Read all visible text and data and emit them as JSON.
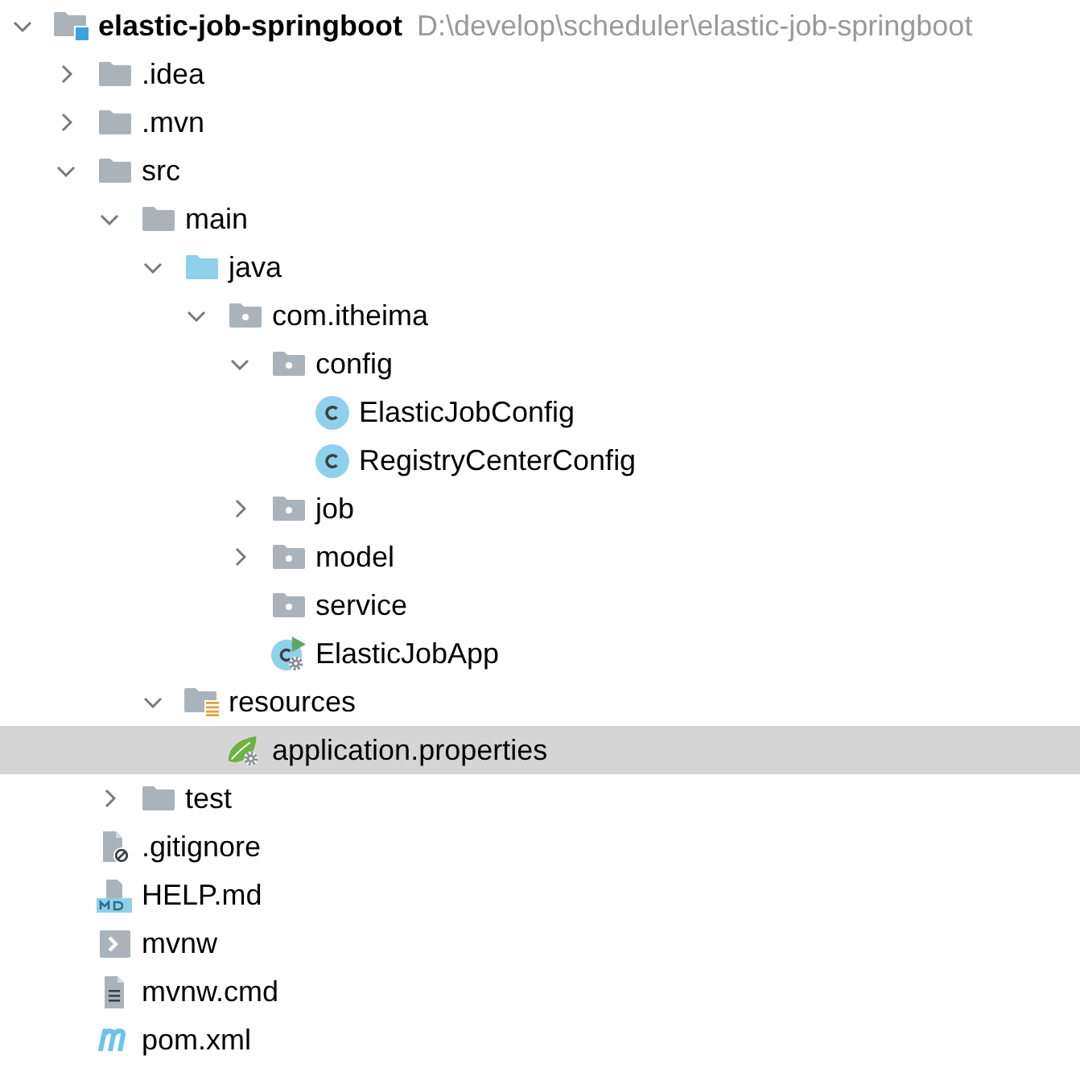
{
  "project_tree": {
    "items": [
      {
        "kind": "module",
        "name": "elastic-job-springboot",
        "path": "D:\\develop\\scheduler\\elastic-job-springboot",
        "expanded": true,
        "selected": false,
        "children": [
          {
            "kind": "folder",
            "name": ".idea",
            "expanded": false,
            "selected": false
          },
          {
            "kind": "folder",
            "name": ".mvn",
            "expanded": false,
            "selected": false
          },
          {
            "kind": "folder",
            "name": "src",
            "expanded": true,
            "selected": false,
            "children": [
              {
                "kind": "folder",
                "name": "main",
                "expanded": true,
                "selected": false,
                "children": [
                  {
                    "kind": "source_folder",
                    "name": "java",
                    "expanded": true,
                    "selected": false,
                    "children": [
                      {
                        "kind": "package",
                        "name": "com.itheima",
                        "expanded": true,
                        "selected": false,
                        "children": [
                          {
                            "kind": "package",
                            "name": "config",
                            "expanded": true,
                            "selected": false,
                            "children": [
                              {
                                "kind": "class",
                                "name": "ElasticJobConfig",
                                "selected": false
                              },
                              {
                                "kind": "class",
                                "name": "RegistryCenterConfig",
                                "selected": false
                              }
                            ]
                          },
                          {
                            "kind": "package",
                            "name": "job",
                            "expanded": false,
                            "selected": false
                          },
                          {
                            "kind": "package",
                            "name": "model",
                            "expanded": false,
                            "selected": false
                          },
                          {
                            "kind": "package",
                            "name": "service",
                            "selected": false
                          },
                          {
                            "kind": "app_class",
                            "name": "ElasticJobApp",
                            "selected": false
                          }
                        ]
                      }
                    ]
                  },
                  {
                    "kind": "resource_folder",
                    "name": "resources",
                    "expanded": true,
                    "selected": false,
                    "children": [
                      {
                        "kind": "properties",
                        "name": "application.properties",
                        "selected": true
                      }
                    ]
                  }
                ]
              },
              {
                "kind": "folder",
                "name": "test",
                "expanded": false,
                "selected": false
              }
            ]
          },
          {
            "kind": "ignore_file",
            "name": ".gitignore",
            "selected": false
          },
          {
            "kind": "markdown",
            "name": "HELP.md",
            "selected": false
          },
          {
            "kind": "script",
            "name": "mvnw",
            "selected": false
          },
          {
            "kind": "text_file",
            "name": "mvnw.cmd",
            "selected": false
          },
          {
            "kind": "maven_pom",
            "name": "pom.xml",
            "selected": false
          }
        ]
      }
    ]
  }
}
